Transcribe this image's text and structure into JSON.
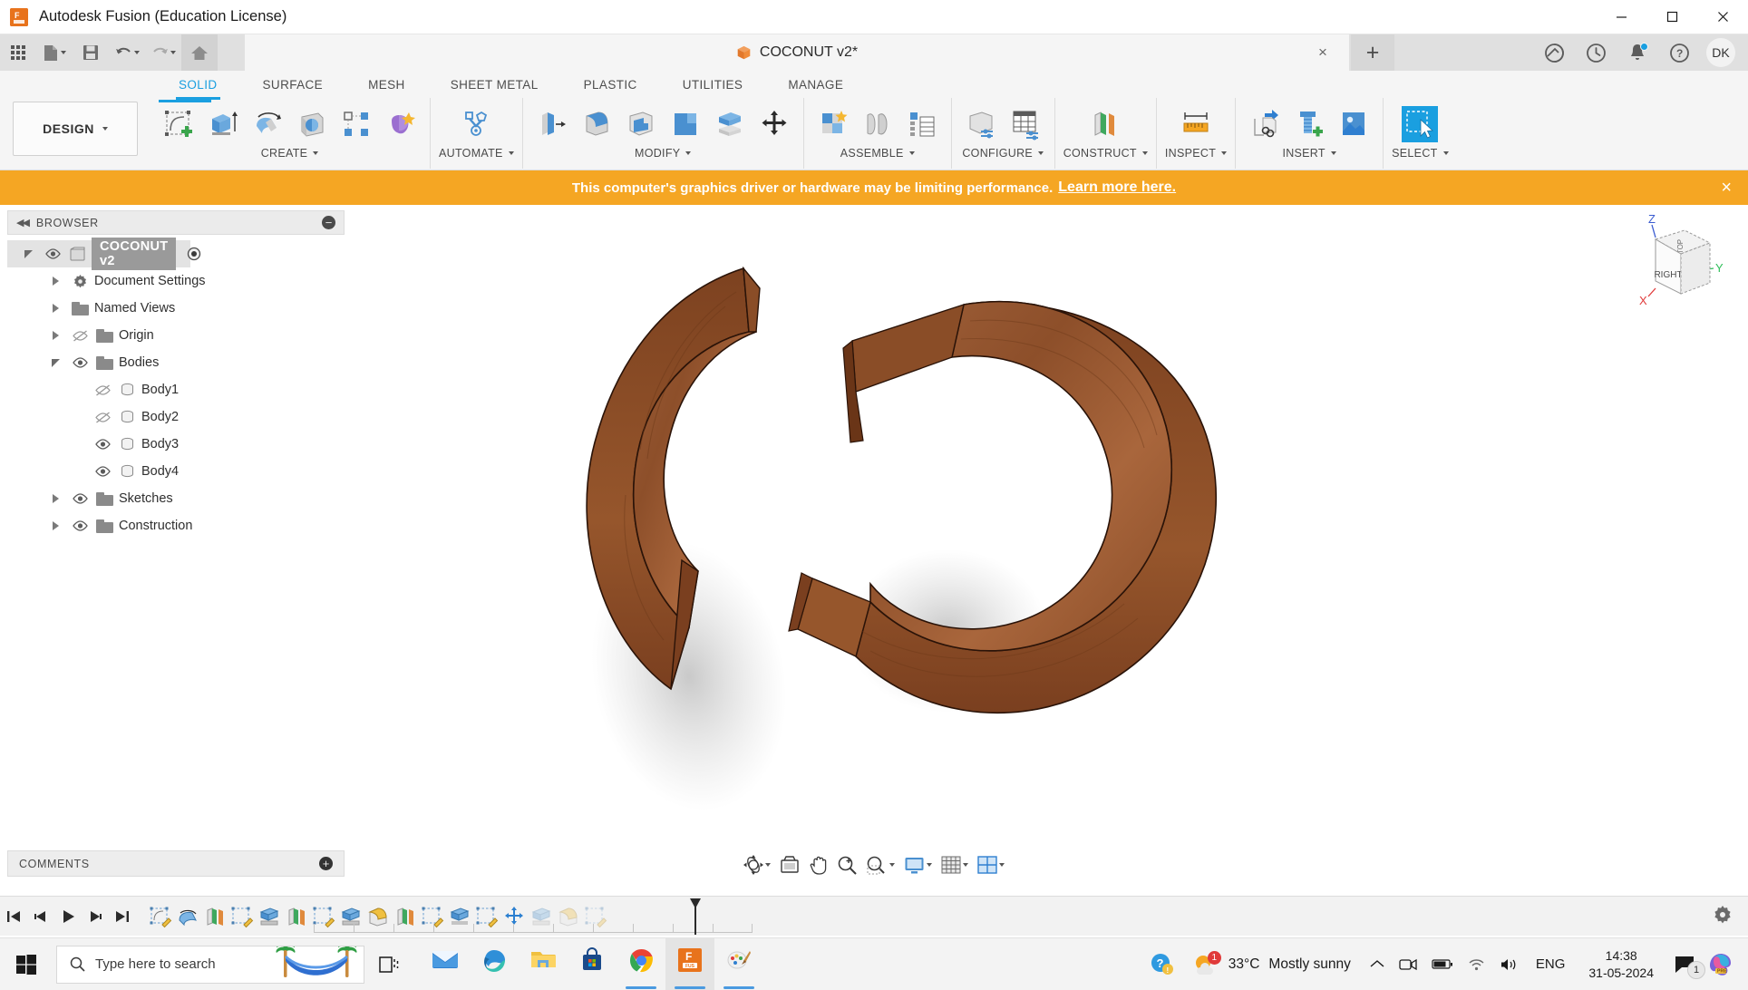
{
  "window": {
    "app_title": "Autodesk Fusion (Education License)",
    "logo_text": "F",
    "minimize": "minimize",
    "maximize": "maximize",
    "close": "close"
  },
  "document_tab": {
    "label": "COCONUT v2*",
    "close_label": "×",
    "new_tab_label": "+"
  },
  "topright": {
    "extensions_icon": "extensions-icon",
    "job_status_icon": "job-status-icon",
    "notifications_icon": "bell-icon",
    "help_icon": "help-icon",
    "user_initials": "DK"
  },
  "quick_access": {
    "app_grid": "app-grid-icon",
    "file": "file-icon",
    "save": "save-icon",
    "undo": "undo-icon",
    "redo": "redo-icon",
    "home": "home-icon"
  },
  "ribbon": {
    "workspace_label": "DESIGN",
    "tabs": [
      {
        "label": "SOLID",
        "active": true
      },
      {
        "label": "SURFACE",
        "active": false
      },
      {
        "label": "MESH",
        "active": false
      },
      {
        "label": "SHEET METAL",
        "active": false
      },
      {
        "label": "PLASTIC",
        "active": false
      },
      {
        "label": "UTILITIES",
        "active": false
      },
      {
        "label": "MANAGE",
        "active": false
      }
    ],
    "panels": [
      {
        "label": "CREATE",
        "tools": [
          "create-sketch-icon",
          "extrude-icon",
          "revolve-icon",
          "sweep-icon",
          "pattern-icon",
          "create-form-icon"
        ]
      },
      {
        "label": "AUTOMATE",
        "tools": [
          "automate-icon"
        ]
      },
      {
        "label": "MODIFY",
        "tools": [
          "press-pull-icon",
          "fillet-icon",
          "shell-icon",
          "combine-icon",
          "split-body-icon",
          "move-copy-icon"
        ]
      },
      {
        "label": "ASSEMBLE",
        "tools": [
          "new-component-icon",
          "joint-icon",
          "assemble-list-icon"
        ]
      },
      {
        "label": "CONFIGURE",
        "tools": [
          "configure-body-icon",
          "configure-table-icon"
        ]
      },
      {
        "label": "CONSTRUCT",
        "tools": [
          "construct-plane-icon"
        ]
      },
      {
        "label": "INSPECT",
        "tools": [
          "measure-icon"
        ]
      },
      {
        "label": "INSERT",
        "tools": [
          "insert-derive-icon",
          "insert-mcmaster-icon",
          "insert-image-icon"
        ]
      },
      {
        "label": "SELECT",
        "tools": [
          "select-window-icon"
        ]
      }
    ]
  },
  "banner": {
    "message": "This computer's graphics driver or hardware may be limiting performance.",
    "link_text": "Learn more here.",
    "close_label": "×",
    "background_color": "#f5a623"
  },
  "browser": {
    "title": "BROWSER",
    "collapse_label": "◀◀",
    "minus_label": "−",
    "root": {
      "label": "COCONUT v2",
      "expanded": true
    },
    "items": [
      {
        "label": "Document Settings",
        "icon": "gear-icon",
        "expandable": true,
        "indent": 1,
        "eye": "none"
      },
      {
        "label": "Named Views",
        "icon": "folder-icon",
        "expandable": true,
        "indent": 1,
        "eye": "none"
      },
      {
        "label": "Origin",
        "icon": "folder-icon",
        "expandable": true,
        "indent": 1,
        "eye": "hidden"
      },
      {
        "label": "Bodies",
        "icon": "folder-icon",
        "expandable": true,
        "expanded": true,
        "indent": 1,
        "eye": "visible"
      },
      {
        "label": "Body1",
        "icon": "body-icon",
        "expandable": false,
        "indent": 2,
        "eye": "hidden"
      },
      {
        "label": "Body2",
        "icon": "body-icon",
        "expandable": false,
        "indent": 2,
        "eye": "hidden"
      },
      {
        "label": "Body3",
        "icon": "body-icon",
        "expandable": false,
        "indent": 2,
        "eye": "visible"
      },
      {
        "label": "Body4",
        "icon": "body-icon",
        "expandable": false,
        "indent": 2,
        "eye": "visible"
      },
      {
        "label": "Sketches",
        "icon": "folder-icon",
        "expandable": true,
        "indent": 1,
        "eye": "visible"
      },
      {
        "label": "Construction",
        "icon": "folder-icon",
        "expandable": true,
        "indent": 1,
        "eye": "visible"
      }
    ]
  },
  "viewcube": {
    "face_label": "RIGHT",
    "top_label": "TOP",
    "axis_z": "Z",
    "axis_y": "Y",
    "axis_x": "X"
  },
  "model": {
    "material_color": "#9a5a30",
    "material_dark": "#6f3b1c",
    "material_light": "#b06d3c",
    "body_count": 2,
    "description": "two wooden C-shaped arc bodies"
  },
  "navbar": {
    "items": [
      "orbit-icon",
      "look-at-icon",
      "pan-icon",
      "zoom-icon",
      "zoom-window-icon",
      "display-settings-icon",
      "grid-snap-icon",
      "viewports-icon"
    ]
  },
  "comments": {
    "title": "COMMENTS",
    "add_label": "+"
  },
  "timeline": {
    "controls": [
      "go-to-beginning-icon",
      "step-back-icon",
      "play-icon",
      "step-forward-icon",
      "go-to-end-icon"
    ],
    "features": [
      {
        "icon": "sketch-icon",
        "dim": false
      },
      {
        "icon": "revolve-icon",
        "dim": false
      },
      {
        "icon": "plane-icon",
        "dim": false
      },
      {
        "icon": "sketch-icon",
        "dim": false
      },
      {
        "icon": "extrude-icon",
        "dim": false
      },
      {
        "icon": "plane-icon",
        "dim": false
      },
      {
        "icon": "sketch-icon",
        "dim": false
      },
      {
        "icon": "extrude-icon",
        "dim": false
      },
      {
        "icon": "fillet-icon",
        "dim": false
      },
      {
        "icon": "plane-icon",
        "dim": false
      },
      {
        "icon": "sketch-icon",
        "dim": false
      },
      {
        "icon": "extrude-icon",
        "dim": false
      },
      {
        "icon": "sketch-icon",
        "dim": false
      },
      {
        "icon": "move-icon",
        "dim": false
      },
      {
        "icon": "extrude-icon",
        "dim": true
      },
      {
        "icon": "fillet-icon",
        "dim": true
      },
      {
        "icon": "sketch-icon",
        "dim": true
      }
    ],
    "settings_icon": "gear-icon"
  },
  "taskbar": {
    "start_label": "start-icon",
    "search_placeholder": "Type here to search",
    "task_view": "task-view-icon",
    "apps": [
      {
        "name": "mail-app",
        "running": false,
        "active": false
      },
      {
        "name": "edge-app",
        "running": false,
        "active": false
      },
      {
        "name": "file-explorer-app",
        "running": false,
        "active": false
      },
      {
        "name": "microsoft-store-app",
        "running": false,
        "active": false
      },
      {
        "name": "chrome-app",
        "running": true,
        "active": false
      },
      {
        "name": "fusion-app",
        "running": true,
        "active": true
      },
      {
        "name": "paint3d-app",
        "running": true,
        "active": false
      }
    ],
    "tray": {
      "help_icon": "help-tray-icon",
      "weather_temp": "33°C",
      "weather_desc": "Mostly sunny",
      "weather_badge": "1",
      "show_hidden": "chevron-up-icon",
      "meet_now_icon": "meet-now-icon",
      "battery_icon": "battery-icon",
      "network_icon": "network-icon",
      "volume_icon": "volume-icon",
      "language": "ENG",
      "time": "14:38",
      "date": "31-05-2024",
      "notification_count": "1",
      "copilot_icon": "copilot-icon"
    }
  }
}
